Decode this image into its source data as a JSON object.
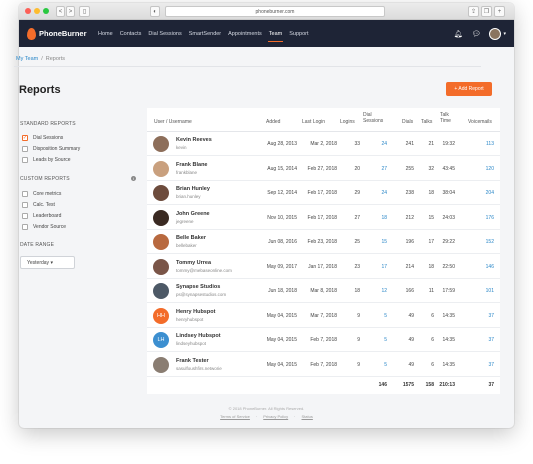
{
  "browser": {
    "url": "phoneburner.com",
    "back": "<",
    "forward": ">",
    "new_tab": "+"
  },
  "nav": {
    "logo": "PhoneBurner",
    "links": [
      "Home",
      "Contacts",
      "Dial Sessions",
      "SmartSender",
      "Appointments",
      "Team",
      "Support"
    ],
    "active": "Team"
  },
  "breadcrumb": {
    "parent": "My Team",
    "separator": "/",
    "current": "Reports"
  },
  "page": {
    "title": "Reports",
    "add_button": "+ Add Report"
  },
  "sidebar": {
    "standard_heading": "STANDARD REPORTS",
    "standard_items": [
      "Dial Sessions",
      "Disposition Summary",
      "Leads by Source"
    ],
    "custom_heading": "CUSTOM REPORTS",
    "custom_items": [
      "Core metrics",
      "Calc. Test",
      "Leaderboard",
      "Vendor Source"
    ],
    "date_heading": "DATE RANGE",
    "date_value": "Yesterday ▾"
  },
  "table": {
    "headers": {
      "user": "User / Username",
      "added": "Added",
      "last_login": "Last Login",
      "logins": "Logins",
      "dial_sessions_1": "Dial",
      "dial_sessions_2": "Sessions",
      "dials": "Dials",
      "talks": "Talks",
      "talk_time_1": "Talk",
      "talk_time_2": "Time",
      "voicemails": "Voicemails"
    },
    "rows": [
      {
        "name": "Kevin Reeves",
        "username": "kevin",
        "added": "Aug 28, 2013",
        "last_login": "Mar 2, 2018",
        "logins": "33",
        "sessions": "24",
        "dials": "241",
        "talks": "21",
        "talk_time": "19:32",
        "voicemails": "113"
      },
      {
        "name": "Frank Blane",
        "username": "frankblane",
        "added": "Aug 15, 2014",
        "last_login": "Feb 27, 2018",
        "logins": "20",
        "sessions": "27",
        "dials": "255",
        "talks": "32",
        "talk_time": "43:45",
        "voicemails": "120"
      },
      {
        "name": "Brian Hunley",
        "username": "brian.hunley",
        "added": "Sep 12, 2014",
        "last_login": "Feb 17, 2018",
        "logins": "29",
        "sessions": "24",
        "dials": "238",
        "talks": "18",
        "talk_time": "38:04",
        "voicemails": "204"
      },
      {
        "name": "John Greene",
        "username": "jegreene",
        "added": "Nov 10, 2015",
        "last_login": "Feb 17, 2018",
        "logins": "27",
        "sessions": "18",
        "dials": "212",
        "talks": "15",
        "talk_time": "24:03",
        "voicemails": "176"
      },
      {
        "name": "Belle Baker",
        "username": "bellebaker",
        "added": "Jun 08, 2016",
        "last_login": "Feb 23, 2018",
        "logins": "25",
        "sessions": "15",
        "dials": "196",
        "talks": "17",
        "talk_time": "29:22",
        "voicemails": "152"
      },
      {
        "name": "Tommy Urrea",
        "username": "tommy@mebaseonline.com",
        "added": "May 09, 2017",
        "last_login": "Jan 17, 2018",
        "logins": "23",
        "sessions": "17",
        "dials": "214",
        "talks": "18",
        "talk_time": "22:50",
        "voicemails": "146"
      },
      {
        "name": "Synapse Studios",
        "username": "ps@synapsestudios.com",
        "added": "Jun 18, 2018",
        "last_login": "Mar 8, 2018",
        "logins": "18",
        "sessions": "12",
        "dials": "166",
        "talks": "11",
        "talk_time": "17:59",
        "voicemails": "101"
      },
      {
        "name": "Henry Hubspot",
        "username": "henryhubspot",
        "added": "May 04, 2015",
        "last_login": "Mar 7, 2018",
        "logins": "9",
        "sessions": "5",
        "dials": "49",
        "talks": "6",
        "talk_time": "14:35",
        "voicemails": "37",
        "initials": "HH"
      },
      {
        "name": "Lindsey Hubspot",
        "username": "lindseyhubspot",
        "added": "May 04, 2015",
        "last_login": "Feb 7, 2018",
        "logins": "9",
        "sessions": "5",
        "dials": "49",
        "talks": "6",
        "talk_time": "14:35",
        "voicemails": "37",
        "initials": "LH"
      },
      {
        "name": "Frank Tester",
        "username": "sasulfoushfirs.networie",
        "added": "May 04, 2015",
        "last_login": "Feb 7, 2018",
        "logins": "9",
        "sessions": "5",
        "dials": "49",
        "talks": "6",
        "talk_time": "14:35",
        "voicemails": "37"
      }
    ],
    "totals": {
      "sessions": "146",
      "dials": "1575",
      "talks": "158",
      "talk_time": "210:13",
      "voicemails": "37"
    }
  },
  "footer": {
    "copyright": "© 2018 PhoneBurner. All Rights Reserved.",
    "links": [
      "Terms of Service",
      "Privacy Policy",
      "Status"
    ],
    "separator": "·"
  },
  "colors": {
    "accent": "#f36c2a",
    "nav_bg": "#1e2436",
    "link": "#2a87c8"
  }
}
